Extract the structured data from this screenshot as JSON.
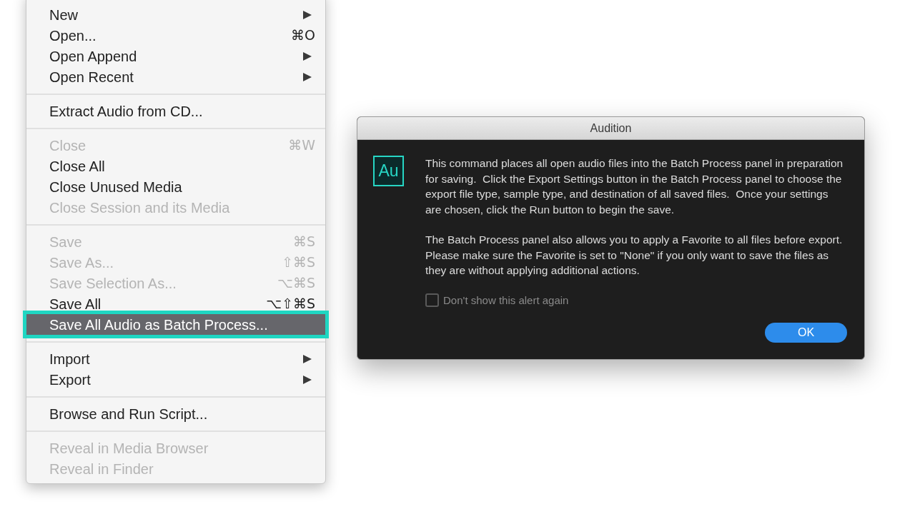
{
  "menu": {
    "sections": [
      {
        "items": [
          {
            "label": "New",
            "submenu": true,
            "disabled": false,
            "selected": false
          },
          {
            "label": "Open...",
            "shortcut": "⌘O",
            "submenu": false,
            "disabled": false,
            "selected": false
          },
          {
            "label": "Open Append",
            "submenu": true,
            "disabled": false,
            "selected": false
          },
          {
            "label": "Open Recent",
            "submenu": true,
            "disabled": false,
            "selected": false
          }
        ]
      },
      {
        "items": [
          {
            "label": "Extract Audio from CD...",
            "submenu": false,
            "disabled": false,
            "selected": false
          }
        ]
      },
      {
        "items": [
          {
            "label": "Close",
            "shortcut": "⌘W",
            "submenu": false,
            "disabled": true,
            "selected": false
          },
          {
            "label": "Close All",
            "submenu": false,
            "disabled": false,
            "selected": false
          },
          {
            "label": "Close Unused Media",
            "submenu": false,
            "disabled": false,
            "selected": false
          },
          {
            "label": "Close Session and its Media",
            "submenu": false,
            "disabled": true,
            "selected": false
          }
        ]
      },
      {
        "items": [
          {
            "label": "Save",
            "shortcut": "⌘S",
            "submenu": false,
            "disabled": true,
            "selected": false
          },
          {
            "label": "Save As...",
            "shortcut": "⇧⌘S",
            "submenu": false,
            "disabled": true,
            "selected": false
          },
          {
            "label": "Save Selection As...",
            "shortcut": "⌥⌘S",
            "submenu": false,
            "disabled": true,
            "selected": false
          },
          {
            "label": "Save All",
            "shortcut": "⌥⇧⌘S",
            "submenu": false,
            "disabled": false,
            "selected": false
          },
          {
            "label": "Save All Audio as Batch Process...",
            "submenu": false,
            "disabled": false,
            "selected": true
          }
        ]
      },
      {
        "items": [
          {
            "label": "Import",
            "submenu": true,
            "disabled": false,
            "selected": false
          },
          {
            "label": "Export",
            "submenu": true,
            "disabled": false,
            "selected": false
          }
        ]
      },
      {
        "items": [
          {
            "label": "Browse and Run Script...",
            "submenu": false,
            "disabled": false,
            "selected": false
          }
        ]
      },
      {
        "items": [
          {
            "label": "Reveal in Media Browser",
            "submenu": false,
            "disabled": true,
            "selected": false
          },
          {
            "label": "Reveal in Finder",
            "submenu": false,
            "disabled": true,
            "selected": false
          }
        ]
      }
    ]
  },
  "dialog": {
    "title": "Audition",
    "logo": "Au",
    "paragraphs": [
      "This command places all open audio files into the Batch Process panel in preparation for saving.  Click the Export Settings button in the Batch Process panel to choose the export file type, sample type, and destination of all saved files.  Once your settings are chosen, click the Run button to begin the save.",
      "The Batch Process panel also allows you to apply a Favorite to all files before export.  Please make sure the Favorite is set to \"None\" if you only want to save the files as they are without applying additional actions."
    ],
    "checkbox": {
      "label": "Don't show this alert again",
      "checked": false
    },
    "button": "OK"
  }
}
